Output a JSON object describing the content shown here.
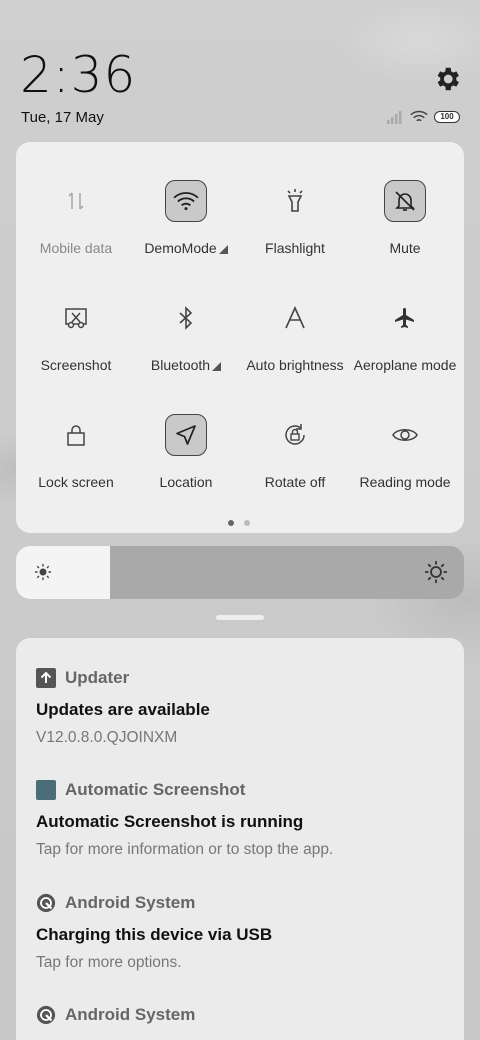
{
  "status": {
    "time": "2:36",
    "date": "Tue, 17 May",
    "battery": "100",
    "settings_icon": "gear-icon"
  },
  "quick_settings": {
    "tiles": [
      {
        "label": "Mobile data",
        "icon": "mobile-data-icon",
        "active": false,
        "dim": true
      },
      {
        "label": "DemoMode",
        "icon": "wifi-icon",
        "active": true,
        "expandable": true
      },
      {
        "label": "Flashlight",
        "icon": "flashlight-icon",
        "active": false
      },
      {
        "label": "Mute",
        "icon": "bell-off-icon",
        "active": true
      },
      {
        "label": "Screenshot",
        "icon": "scissors-icon",
        "active": false
      },
      {
        "label": "Bluetooth",
        "icon": "bluetooth-icon",
        "active": false,
        "expandable": true
      },
      {
        "label": "Auto brightness",
        "icon": "auto-brightness-icon",
        "active": false
      },
      {
        "label": "Aeroplane mode",
        "icon": "airplane-icon",
        "active": false
      },
      {
        "label": "Lock screen",
        "icon": "lock-icon",
        "active": false
      },
      {
        "label": "Location",
        "icon": "location-arrow-icon",
        "active": true
      },
      {
        "label": "Rotate off",
        "icon": "rotate-lock-icon",
        "active": false
      },
      {
        "label": "Reading mode",
        "icon": "eye-icon",
        "active": false
      }
    ],
    "page_count": 2,
    "current_page": 1
  },
  "brightness": {
    "level": 0.21
  },
  "notifications": [
    {
      "app": "Updater",
      "icon": "upload-arrow-icon",
      "title": "Updates are available",
      "body": "V12.0.8.0.QJOINXM"
    },
    {
      "app": "Automatic Screenshot",
      "icon": "app-square-icon",
      "title": "Automatic Screenshot is running",
      "body": "Tap for more information or to stop the app."
    },
    {
      "app": "Android System",
      "icon": "android-system-icon",
      "title": "Charging this device via USB",
      "body": "Tap for more options."
    },
    {
      "app": "Android System",
      "icon": "android-system-icon",
      "title": "",
      "body": ""
    }
  ],
  "colors": {
    "accent_square": "#4a6d78"
  }
}
